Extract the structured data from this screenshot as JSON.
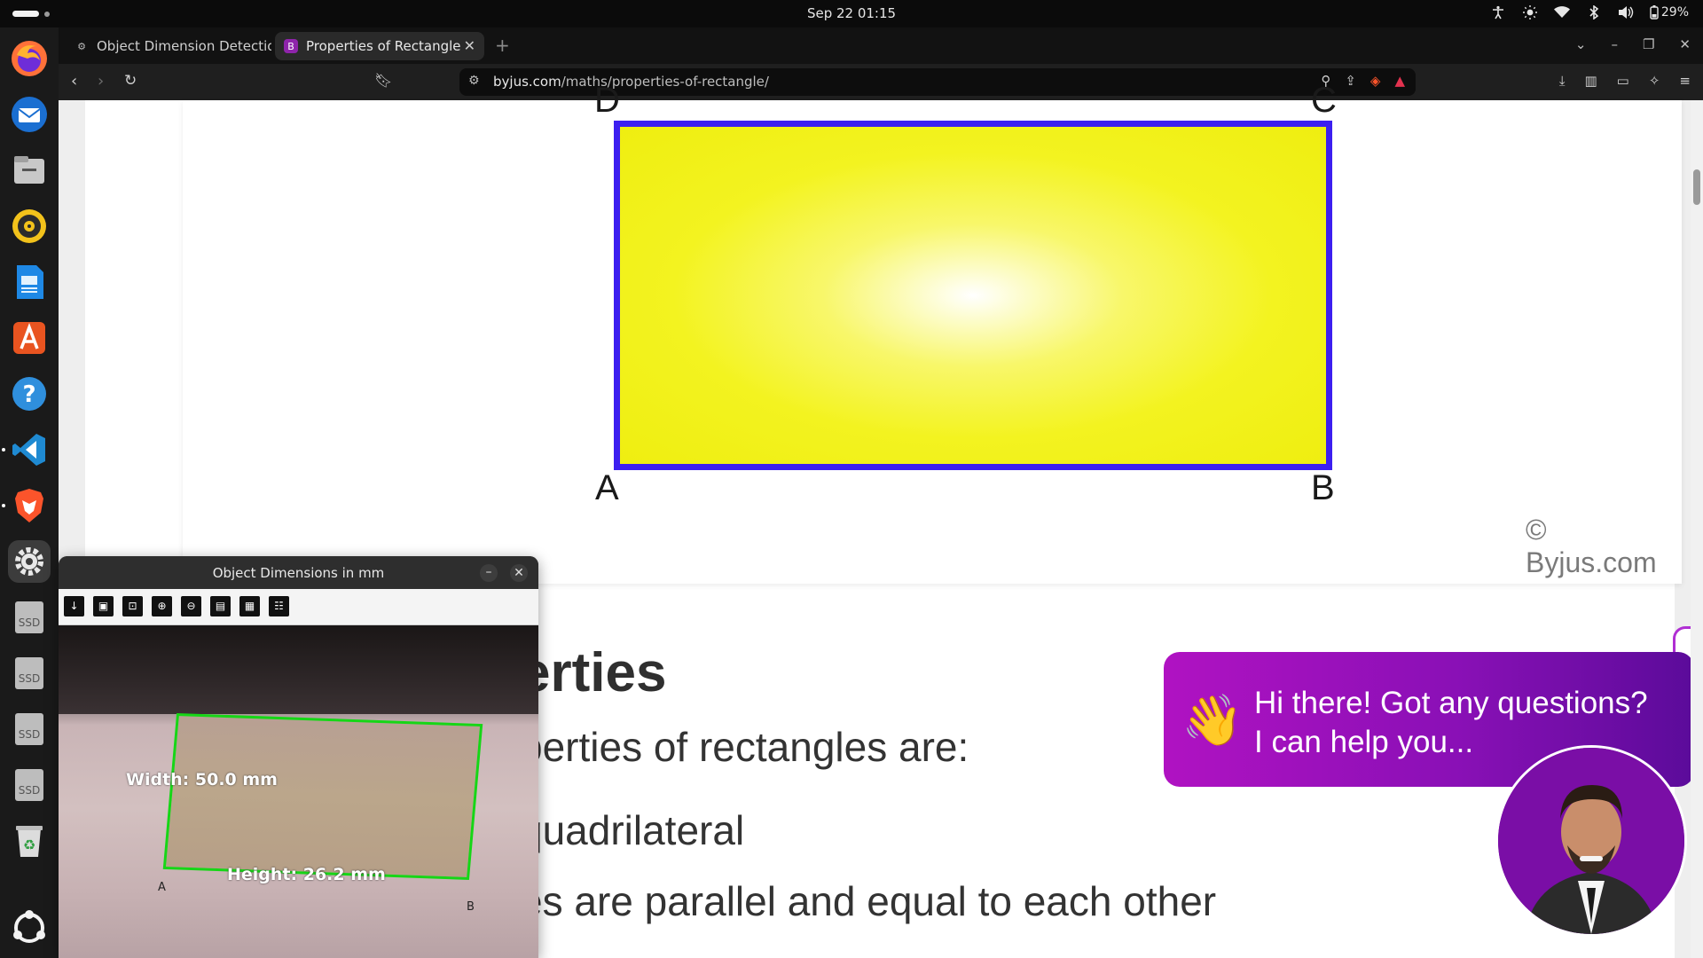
{
  "system": {
    "datetime": "Sep 22  01:15",
    "battery": "29%"
  },
  "browser": {
    "tabs": [
      {
        "title": "Object Dimension Detection",
        "active": false
      },
      {
        "title": "Properties of Rectangle",
        "active": true
      }
    ],
    "url_domain": "byjus.com",
    "url_path": "/maths/properties-of-rectangle/"
  },
  "page": {
    "figure": {
      "vertex_a": "A",
      "vertex_b": "B",
      "vertex_c": "C",
      "vertex_d": "D",
      "copyright": "© Byjus.com"
    },
    "heading": "erties",
    "line1": "perties of rectangles are:",
    "line2": "quadrilateral",
    "line3": "es are parallel and equal to each other"
  },
  "chat": {
    "line1": "Hi there! Got any questions?",
    "line2": "I can help you..."
  },
  "cv_window": {
    "title": "Object Dimensions in mm",
    "width_label": "Width: 50.0 mm",
    "height_label": "Height: 26.2 mm",
    "corner_a": "A",
    "corner_b": "B"
  },
  "dock": {
    "ssd_label": "SSD"
  },
  "colors": {
    "rect_border": "#3c1ff0",
    "rect_fill": "#f3f320",
    "chat_gradient_start": "#b012c2",
    "chat_gradient_end": "#5b0b9a",
    "detect_outline": "#16d616"
  }
}
